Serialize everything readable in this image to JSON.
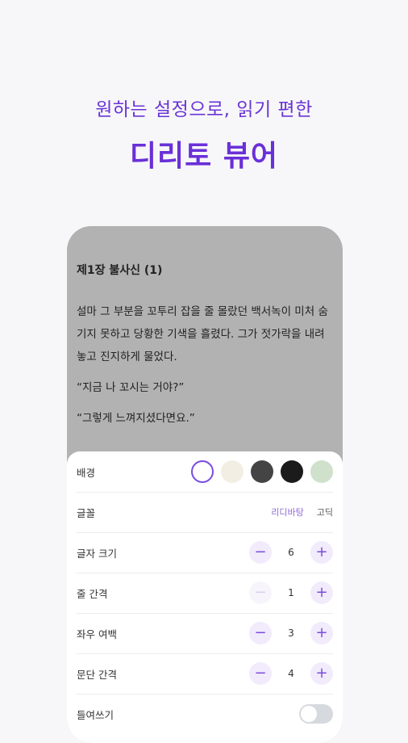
{
  "headline": {
    "sub": "원하는 설정으로, 읽기 편한",
    "main": "디리토 뷰어"
  },
  "reader": {
    "chapter_title": "제1장 불사신 (1)",
    "paragraphs": [
      "설마 그 부분을 꼬투리 잡을 줄 몰랐던 백서녹이 미처 숨기지 못하고 당황한 기색을 흘렸다. 그가 젓가락을 내려놓고 진지하게 물었다.",
      "“지금 나 꼬시는 거야?”",
      "“그렇게 느껴지셨다면요.”"
    ]
  },
  "settings": {
    "background": {
      "label": "배경",
      "colors": [
        "#ffffff",
        "#f2eee4",
        "#444444",
        "#1b1b1b",
        "#cfe1cb"
      ],
      "selected_index": 0
    },
    "font": {
      "label": "글꼴",
      "options": [
        "리디바탕",
        "고딕"
      ],
      "selected": "리디바탕"
    },
    "font_size": {
      "label": "글자 크기",
      "value": "6",
      "minus": "−",
      "plus": "+"
    },
    "line_spacing": {
      "label": "줄 간격",
      "value": "1",
      "minus": "−",
      "plus": "+"
    },
    "side_margin": {
      "label": "좌우 여백",
      "value": "3",
      "minus": "−",
      "plus": "+"
    },
    "paragraph_spacing": {
      "label": "문단 간격",
      "value": "4",
      "minus": "−",
      "plus": "+"
    },
    "indent": {
      "label": "들여쓰기",
      "enabled": false
    }
  }
}
